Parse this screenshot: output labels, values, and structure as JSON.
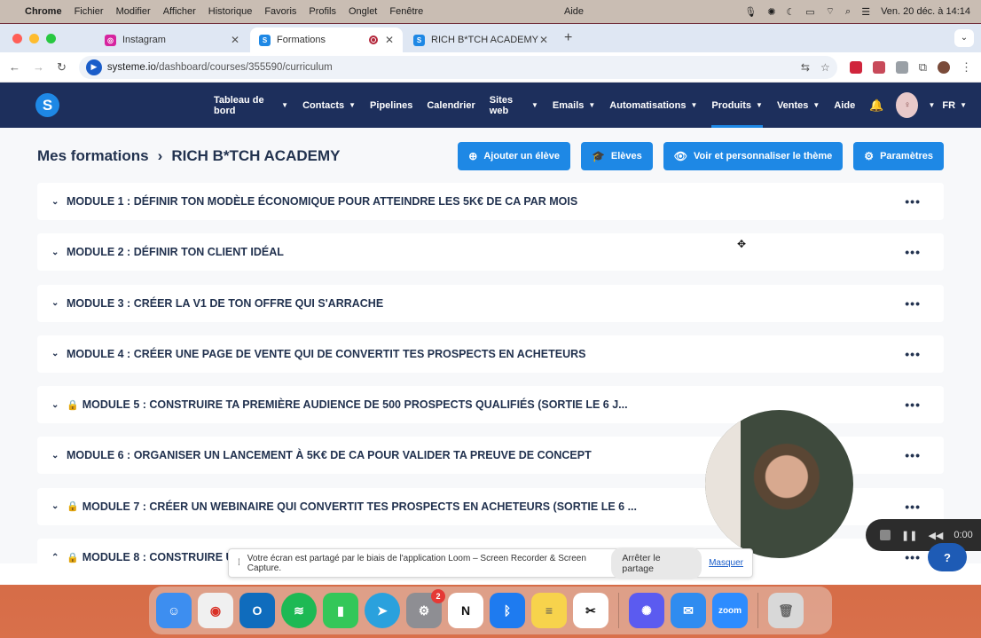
{
  "menubar": {
    "app": "Chrome",
    "items": [
      "Fichier",
      "Modifier",
      "Afficher",
      "Historique",
      "Favoris",
      "Profils",
      "Onglet",
      "Fenêtre"
    ],
    "center": "Aide",
    "datetime": "Ven. 20 déc. à 14:14"
  },
  "tabs": [
    {
      "label": "Instagram",
      "icon": "instagram-icon",
      "color": "#d6249f"
    },
    {
      "label": "Formations",
      "icon": "systeme-icon",
      "color": "#1e88e5"
    },
    {
      "label": "RICH B*TCH ACADEMY",
      "icon": "systeme-icon",
      "color": "#1e88e5"
    }
  ],
  "url": {
    "host": "systeme.io",
    "path": "/dashboard/courses/355590/curriculum"
  },
  "nav": {
    "logo": "S",
    "items": [
      {
        "label": "Tableau de bord",
        "chevron": true
      },
      {
        "label": "Contacts",
        "chevron": true
      },
      {
        "label": "Pipelines",
        "chevron": false
      },
      {
        "label": "Calendrier",
        "chevron": false
      },
      {
        "label": "Sites web",
        "chevron": true
      },
      {
        "label": "Emails",
        "chevron": true
      },
      {
        "label": "Automatisations",
        "chevron": true
      },
      {
        "label": "Produits",
        "chevron": true
      },
      {
        "label": "Ventes",
        "chevron": true
      },
      {
        "label": "Aide",
        "chevron": false
      }
    ],
    "lang": "FR"
  },
  "breadcrumb": {
    "root": "Mes formations",
    "current": "RICH B*TCH ACADEMY"
  },
  "buttons": {
    "add_student": "Ajouter un élève",
    "students": "Elèves",
    "theme": "Voir et personnaliser le thème",
    "settings": "Paramètres"
  },
  "modules": [
    {
      "title": "MODULE 1 : DÉFINIR TON MODÈLE ÉCONOMIQUE POUR ATTEINDRE LES 5K€ DE CA PAR MOIS",
      "locked": false,
      "expanded": false
    },
    {
      "title": "MODULE 2 : DÉFINIR TON CLIENT IDÉAL",
      "locked": false,
      "expanded": false
    },
    {
      "title": "MODULE 3 : CRÉER LA V1 DE TON OFFRE QUI S'ARRACHE",
      "locked": false,
      "expanded": false
    },
    {
      "title": "MODULE 4 : CRÉER UNE PAGE DE VENTE QUI DE CONVERTIT TES PROSPECTS EN ACHETEURS",
      "locked": false,
      "expanded": false
    },
    {
      "title": "MODULE 5 : CONSTRUIRE TA PREMIÈRE AUDIENCE DE 500 PROSPECTS QUALIFIÉS (SORTIE LE 6 J...",
      "locked": true,
      "expanded": false
    },
    {
      "title": "MODULE 6 : ORGANISER UN LANCEMENT À 5K€ DE CA POUR VALIDER TA PREUVE DE CONCEPT",
      "locked": false,
      "expanded": false
    },
    {
      "title": "MODULE 7 : CRÉER UN WEBINAIRE QUI CONVERTIT TES PROSPECTS EN ACHETEURS (SORTIE LE 6 ...",
      "locked": true,
      "expanded": false
    },
    {
      "title": "MODULE 8 : CONSTRUIRE U",
      "locked": true,
      "expanded": true
    }
  ],
  "share_bar": {
    "message": "Votre écran est partagé par le biais de l'application Loom – Screen Recorder & Screen Capture.",
    "stop": "Arrêter le partage",
    "hide": "Masquer"
  },
  "recorder": {
    "time": "0:00"
  },
  "help_fab": "?",
  "dock": {
    "apps": [
      {
        "name": "finder",
        "color": "#3d8ef0",
        "glyph": "☺"
      },
      {
        "name": "chrome",
        "color": "#e8e8e8",
        "glyph": "◉"
      },
      {
        "name": "outlook",
        "color": "#0f6cbd",
        "glyph": "O"
      },
      {
        "name": "spotify",
        "color": "#1db954",
        "glyph": "≋"
      },
      {
        "name": "numbers",
        "color": "#34c759",
        "glyph": "▮"
      },
      {
        "name": "telegram",
        "color": "#2aa1dd",
        "glyph": "➤"
      },
      {
        "name": "system-settings",
        "color": "#8e8e93",
        "glyph": "⚙",
        "badge": "2"
      },
      {
        "name": "notion",
        "color": "#ffffff",
        "glyph": "N"
      },
      {
        "name": "bluetooth",
        "color": "#1e7bf0",
        "glyph": "ᛒ"
      },
      {
        "name": "notes",
        "color": "#f7d34c",
        "glyph": "≡"
      },
      {
        "name": "capcut",
        "color": "#ffffff",
        "glyph": "✂"
      },
      {
        "name": "settings-app",
        "color": "#5b5bf0",
        "glyph": "✺"
      },
      {
        "name": "mail",
        "color": "#2f8cf0",
        "glyph": "✉"
      },
      {
        "name": "zoom",
        "color": "#2d8cff",
        "glyph": "zoom"
      },
      {
        "name": "trash",
        "color": "#d8d8d8",
        "glyph": "🗑"
      }
    ]
  }
}
